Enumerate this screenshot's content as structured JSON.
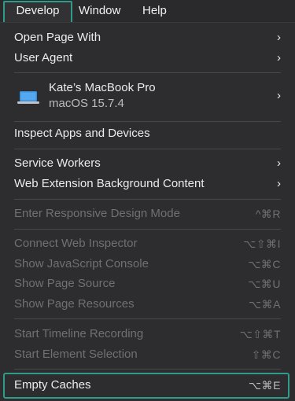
{
  "menubar": {
    "items": [
      {
        "label": "Develop"
      },
      {
        "label": "Window"
      },
      {
        "label": "Help"
      }
    ]
  },
  "menu": {
    "open_page_with": "Open Page With",
    "user_agent": "User Agent",
    "device": {
      "name": "Kate’s MacBook Pro",
      "os": "macOS 15.7.4",
      "icon": "laptop-icon"
    },
    "inspect_apps": "Inspect Apps and Devices",
    "service_workers": "Service Workers",
    "web_extension_bg": "Web Extension Background Content",
    "responsive": {
      "label": "Enter Responsive Design Mode",
      "shortcut": "^⌘R"
    },
    "connect_inspector": {
      "label": "Connect Web Inspector",
      "shortcut": "⌥⇧⌘I"
    },
    "js_console": {
      "label": "Show JavaScript Console",
      "shortcut": "⌥⌘C"
    },
    "page_source": {
      "label": "Show Page Source",
      "shortcut": "⌥⌘U"
    },
    "page_resources": {
      "label": "Show Page Resources",
      "shortcut": "⌥⌘A"
    },
    "timeline": {
      "label": "Start Timeline Recording",
      "shortcut": "⌥⇧⌘T"
    },
    "element_selection": {
      "label": "Start Element Selection",
      "shortcut": "⇧⌘C"
    },
    "empty_caches": {
      "label": "Empty Caches",
      "shortcut": "⌥⌘E"
    }
  },
  "colors": {
    "highlight": "#2e9c88",
    "disabled_text": "#707072",
    "menu_bg": "#2d2d2f"
  }
}
